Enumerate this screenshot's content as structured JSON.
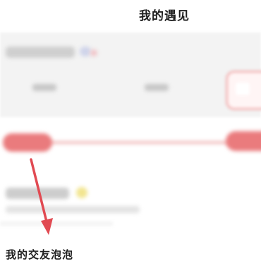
{
  "header": {
    "title": "我的遇见"
  },
  "sections": {
    "bubble_label": "我的交友泡泡"
  },
  "colors": {
    "accent_red": "#e14a52",
    "slider_red": "#ea7b7d"
  },
  "icons": {
    "annotation": "arrow-down-icon"
  }
}
